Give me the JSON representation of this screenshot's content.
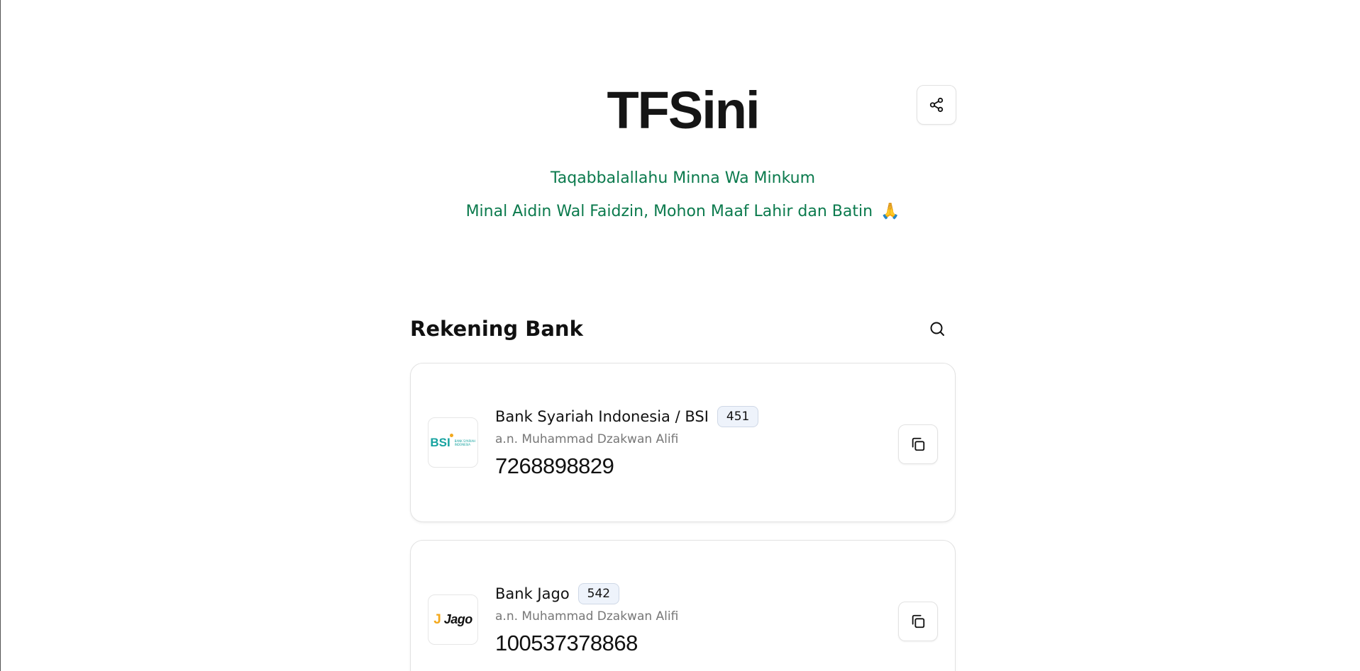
{
  "header": {
    "title": "TFSini",
    "greeting_line1": "Taqabbalallahu Minna Wa Minkum",
    "greeting_line2": "Minal Aidin Wal Faidzin, Mohon Maaf Lahir dan Batin",
    "greeting_emoji": "🙏",
    "share_icon": "share-icon"
  },
  "section": {
    "title": "Rekening Bank",
    "search_icon": "search-icon"
  },
  "accounts": [
    {
      "bank_name": "Bank Syariah Indonesia / BSI",
      "bank_code": "451",
      "holder": "a.n. Muhammad Dzakwan Alifi",
      "number": "7268898829",
      "logo_text": "BSI",
      "logo_sub": "BANK SYARIAH INDONESIA",
      "copy_icon": "copy-icon"
    },
    {
      "bank_name": "Bank Jago",
      "bank_code": "542",
      "holder": "a.n. Muhammad Dzakwan Alifi",
      "number": "100537378868",
      "logo_mark": "J",
      "logo_text": "Jago",
      "copy_icon": "copy-icon"
    }
  ],
  "colors": {
    "greeting": "#0b7a4d",
    "bsi_teal": "#17a3a0",
    "jago_yellow": "#f3a81b",
    "code_badge_bg": "#eef3fb"
  }
}
